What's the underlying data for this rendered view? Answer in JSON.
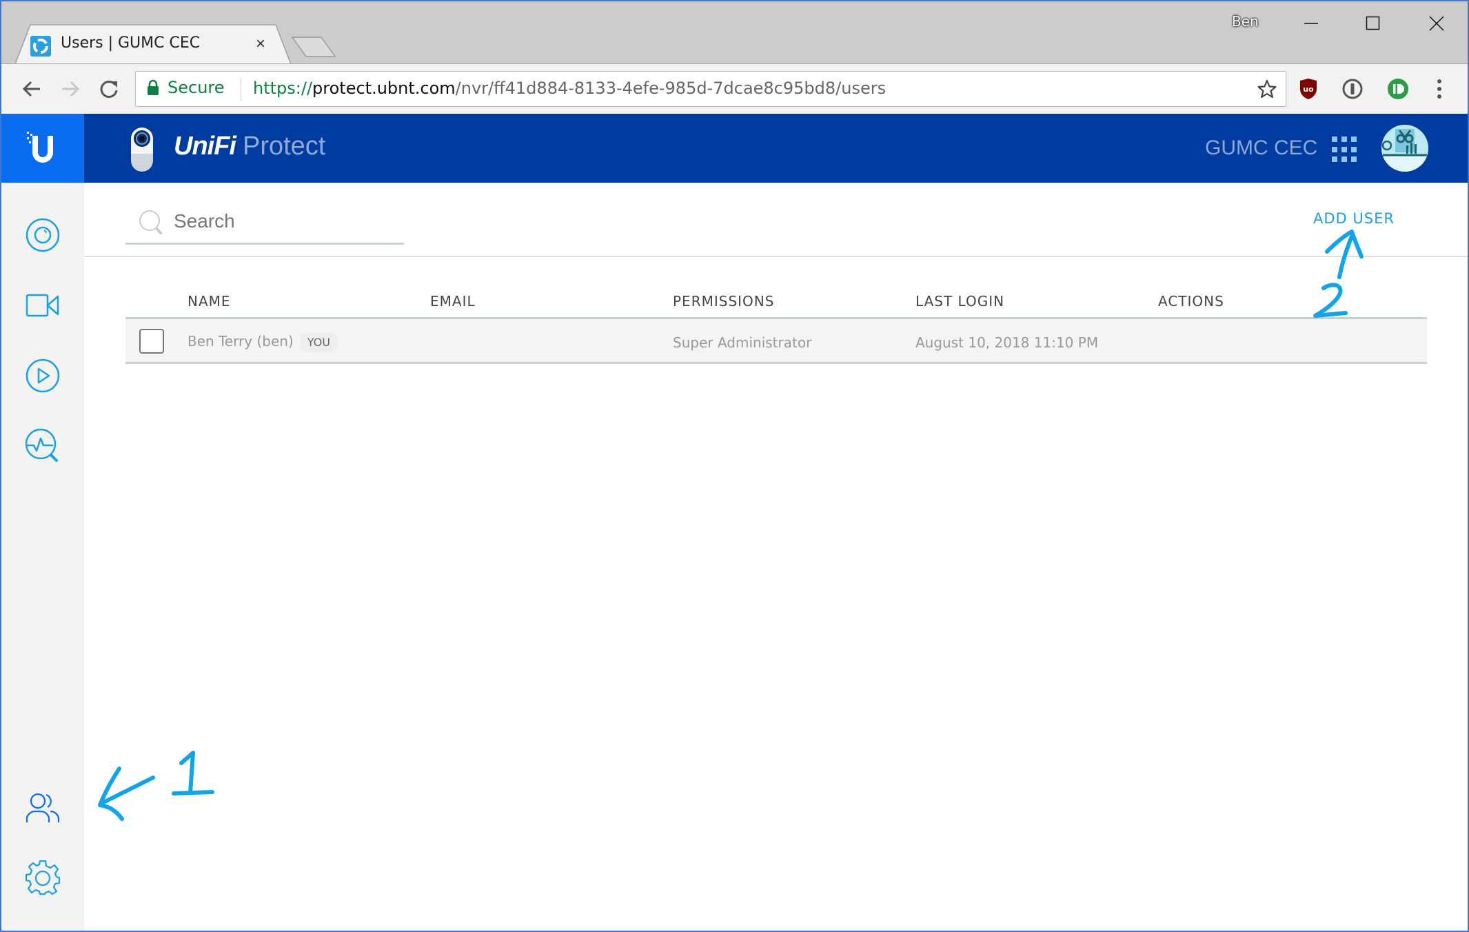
{
  "browser": {
    "tab_title": "Users | GUMC CEC",
    "tab_close": "×",
    "profile_name": "Ben",
    "window_controls": [
      "minimize-icon",
      "maximize-icon",
      "close-icon"
    ],
    "security_label": "Secure",
    "url": {
      "scheme": "https://",
      "host": "protect.ubnt.com",
      "path": "/nvr/ff41d884-8133-4efe-985d-7dcae8c95bd8/users"
    },
    "extensions": [
      "ublock-origin-icon",
      "1password-icon",
      "pushbullet-icon"
    ],
    "extension_labels": {
      "ublock": "uo"
    }
  },
  "app": {
    "brand_unifi": "UniFi",
    "brand_product": "Protect",
    "site_name": "GUMC CEC",
    "colors": {
      "header": "#003b9f",
      "logo_bg": "#0a6cf0",
      "accent": "#1aa0e3",
      "sidebar_bg": "#f3f3f3"
    }
  },
  "sidebar": {
    "items": [
      {
        "name": "dashboard",
        "icon": "dashboard-icon"
      },
      {
        "name": "devices",
        "icon": "video-camera-icon"
      },
      {
        "name": "playback",
        "icon": "play-icon"
      },
      {
        "name": "insights",
        "icon": "activity-search-icon"
      },
      {
        "name": "users",
        "icon": "users-icon"
      },
      {
        "name": "settings",
        "icon": "gear-icon"
      }
    ]
  },
  "toolbar": {
    "search_placeholder": "Search",
    "add_user_label": "ADD USER"
  },
  "table": {
    "columns": [
      "NAME",
      "EMAIL",
      "PERMISSIONS",
      "LAST LOGIN",
      "ACTIONS"
    ],
    "rows": [
      {
        "name": "Ben Terry (ben)",
        "badge": "YOU",
        "email": "",
        "permissions": "Super Administrator",
        "last_login": "August 10, 2018 11:10 PM",
        "actions": ""
      }
    ]
  },
  "annotations": {
    "step1": "1",
    "step2": "2",
    "color": "#12a3e8"
  }
}
